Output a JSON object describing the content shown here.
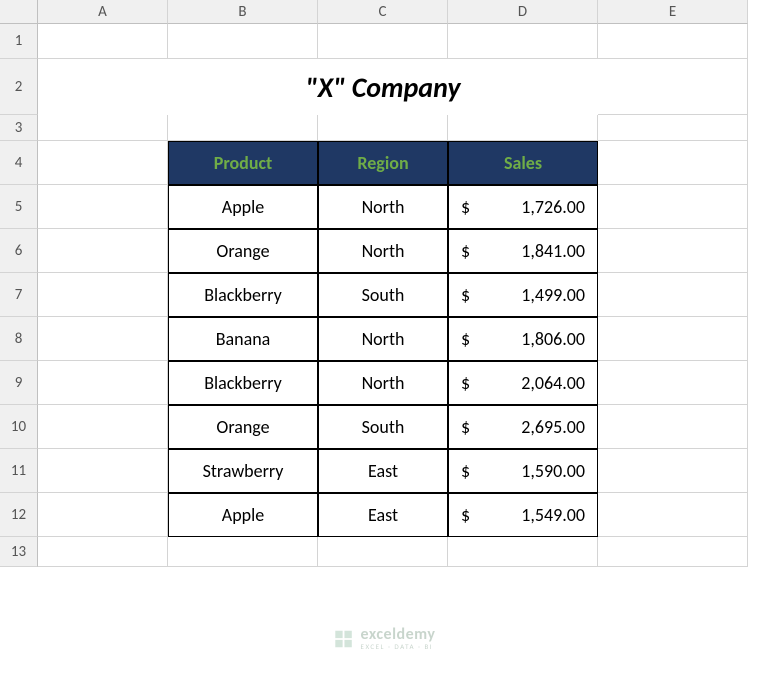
{
  "columns": [
    "A",
    "B",
    "C",
    "D",
    "E"
  ],
  "rows": [
    "1",
    "2",
    "3",
    "4",
    "5",
    "6",
    "7",
    "8",
    "9",
    "10",
    "11",
    "12",
    "13"
  ],
  "title": "\"X\" Company",
  "headers": {
    "product": "Product",
    "region": "Region",
    "sales": "Sales"
  },
  "data": [
    {
      "product": "Apple",
      "region": "North",
      "sales": "1,726.00"
    },
    {
      "product": "Orange",
      "region": "North",
      "sales": "1,841.00"
    },
    {
      "product": "Blackberry",
      "region": "South",
      "sales": "1,499.00"
    },
    {
      "product": "Banana",
      "region": "North",
      "sales": "1,806.00"
    },
    {
      "product": "Blackberry",
      "region": "North",
      "sales": "2,064.00"
    },
    {
      "product": "Orange",
      "region": "South",
      "sales": "2,695.00"
    },
    {
      "product": "Strawberry",
      "region": "East",
      "sales": "1,590.00"
    },
    {
      "product": "Apple",
      "region": "East",
      "sales": "1,549.00"
    }
  ],
  "currency": "$",
  "watermark": {
    "brand": "exceldemy",
    "tagline": "EXCEL · DATA · BI"
  }
}
